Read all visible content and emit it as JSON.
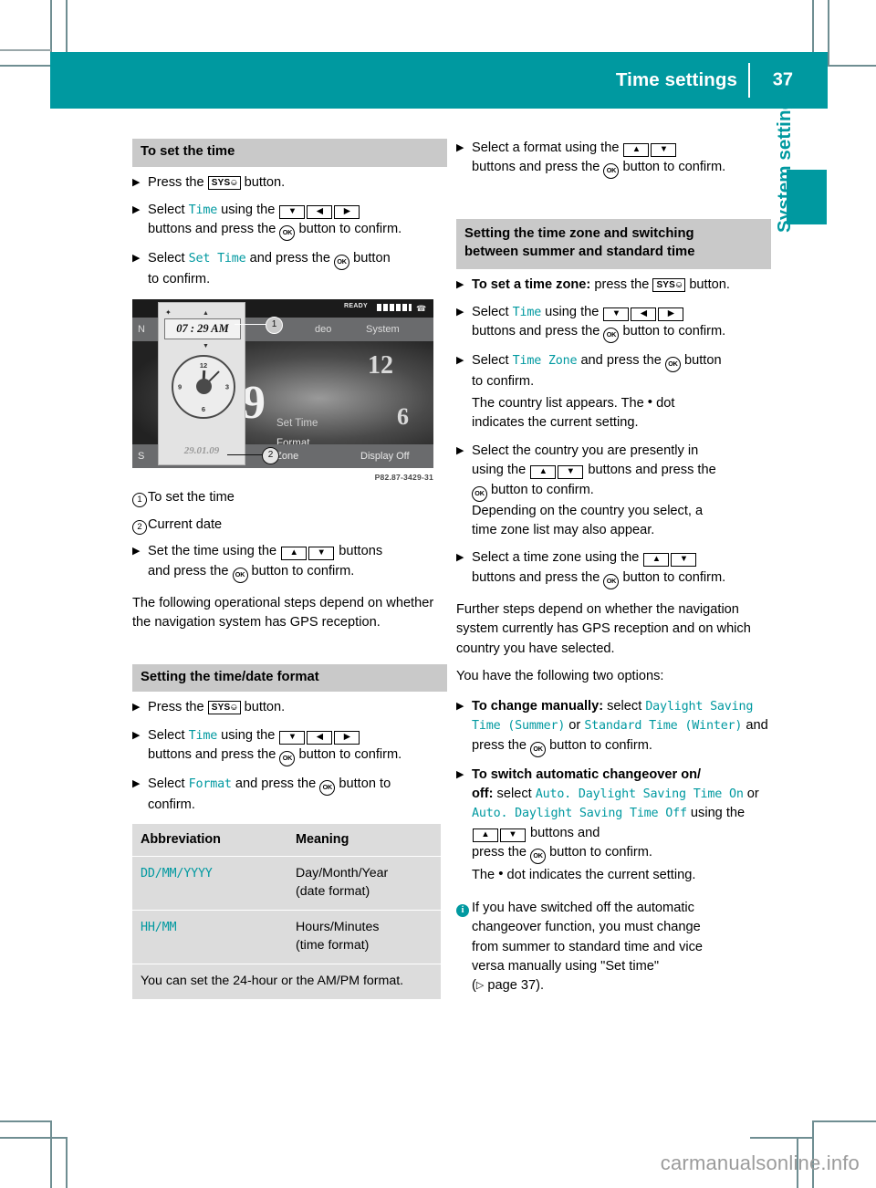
{
  "header": {
    "title": "Time settings",
    "page_number": "37"
  },
  "side_tab": {
    "label": "System settings"
  },
  "watermark": "carmanualsonline.info",
  "left_column": {
    "section1": {
      "heading": "To set the time",
      "steps": [
        {
          "pre": "Press the ",
          "btn": "SYS",
          "post": " button."
        },
        {
          "pre": "Select ",
          "code": "Time",
          "mid": " using the ",
          "post": "buttons and press the ",
          "tail": " button to confirm."
        },
        {
          "pre": "Select ",
          "code": "Set Time",
          "post": " and press the ",
          "tail": " button",
          "tail2": "to confirm."
        }
      ]
    },
    "illustration": {
      "caption": "P82.87-3429-31",
      "screen": {
        "status_ready": "READY",
        "menu_items": [
          "N",
          "deo",
          "System"
        ],
        "time_value": "07 : 29 AM",
        "date_value": "29.01.09",
        "clock_numerals": [
          "12",
          "3",
          "6",
          "9"
        ],
        "dial_numbers": [
          "12",
          "9",
          "6"
        ],
        "right_labels": [
          "Set Time",
          "Format",
          "e Zone"
        ],
        "bottom_left": "S",
        "bottom_right": "Display Off",
        "callout_1": "1",
        "callout_2": "2"
      }
    },
    "legend": [
      {
        "num": "1",
        "text": "To set the time"
      },
      {
        "num": "2",
        "text": "Current date"
      }
    ],
    "after_legend_step": {
      "pre": "Set the time using the ",
      "post": " buttons",
      "line2_pre": "and press the ",
      "line2_post": " button to confirm."
    },
    "paragraph": "The following operational steps depend on whether the navigation system has GPS reception.",
    "section2": {
      "heading": "Setting the time/date format",
      "steps": [
        {
          "pre": "Press the ",
          "btn": "SYS",
          "post": " button."
        },
        {
          "pre": "Select ",
          "code": "Time",
          "mid": " using the ",
          "post": "buttons and press the ",
          "tail": " button to confirm."
        },
        {
          "pre": "Select ",
          "code": "Format",
          "post": " and press the ",
          "tail": " button to",
          "tail2": "confirm."
        }
      ]
    },
    "table": {
      "headers": [
        "Abbreviation",
        "Meaning"
      ],
      "rows": [
        {
          "abbrev_parts": [
            "DD",
            "/",
            "MM",
            "/",
            "YYYY"
          ],
          "meaning_line1": "Day/Month/Year",
          "meaning_line2": "(date format)"
        },
        {
          "abbrev_parts": [
            "HH",
            "/",
            "MM"
          ],
          "meaning_line1": "Hours/Minutes",
          "meaning_line2": "(time format)"
        }
      ],
      "note": "You can set the 24-hour or the AM/PM format."
    }
  },
  "right_column": {
    "top_step": {
      "pre": "Select a format using the ",
      "line2_pre": "buttons and press the ",
      "line2_post": " button to confirm."
    },
    "section3": {
      "heading_line1": "Setting the time zone and switching",
      "heading_line2": "between summer and standard time",
      "step_timezone": {
        "bold": "To set a time zone:",
        "pre": " press the ",
        "btn": "SYS",
        "post": " button."
      },
      "step_time": {
        "pre": "Select ",
        "code": "Time",
        "mid": " using the ",
        "post": "buttons and press the ",
        "tail": " button to confirm."
      },
      "step_timezone_menu": {
        "pre": "Select ",
        "code": "Time Zone",
        "post": " and press the ",
        "tail": " button",
        "line2": "to confirm.",
        "line3_pre": "The country list appears. The ",
        "line3_post": " dot",
        "line4": "indicates the current setting."
      },
      "step_country": {
        "line1": "Select the country you are presently in",
        "line2_pre": "using the ",
        "line2_post": " buttons and press the",
        "line3_post": " button to confirm.",
        "line4": "Depending on the country you select, a",
        "line5": "time zone list may also appear."
      },
      "step_select_tz": {
        "pre": "Select a time zone using the ",
        "line2_pre": "buttons and press the ",
        "line2_post": " button to confirm."
      }
    },
    "paragraph1": "Further steps depend on whether the navigation system currently has GPS reception and on which country you have selected.",
    "paragraph2": "You have the following two options:",
    "step_manual": {
      "bold": "To change manually:",
      "pre": " select ",
      "code1": "Daylight Saving Time (Summer)",
      "mid": " or ",
      "code2": "Standard Time (Winter)",
      "post": " and press the ",
      "tail": " button to",
      "tail2": "confirm."
    },
    "step_auto": {
      "bold_line1": "To switch automatic changeover on/",
      "bold_line2": "off:",
      "pre": " select ",
      "code1": "Auto. Daylight Saving Time On",
      "mid": " or ",
      "code2": "Auto. Daylight Saving Time Off",
      "using": " using the ",
      "post": " buttons and",
      "line_press_pre": "press the ",
      "line_press_post": " button to confirm.",
      "line_dot_pre": "The ",
      "line_dot_post": " dot indicates the current setting."
    },
    "info_note": {
      "line1": "If you have switched off the automatic",
      "line2": "changeover function, you must change",
      "line3": "from summer to standard time and vice",
      "line4": "versa manually using \"Set time\"",
      "line5_pre": "(",
      "line5_post": " page 37)."
    }
  },
  "colors": {
    "accent": "#0099a0",
    "section_bar": "#c9c9c9",
    "table_bg": "#dcdcdc"
  }
}
